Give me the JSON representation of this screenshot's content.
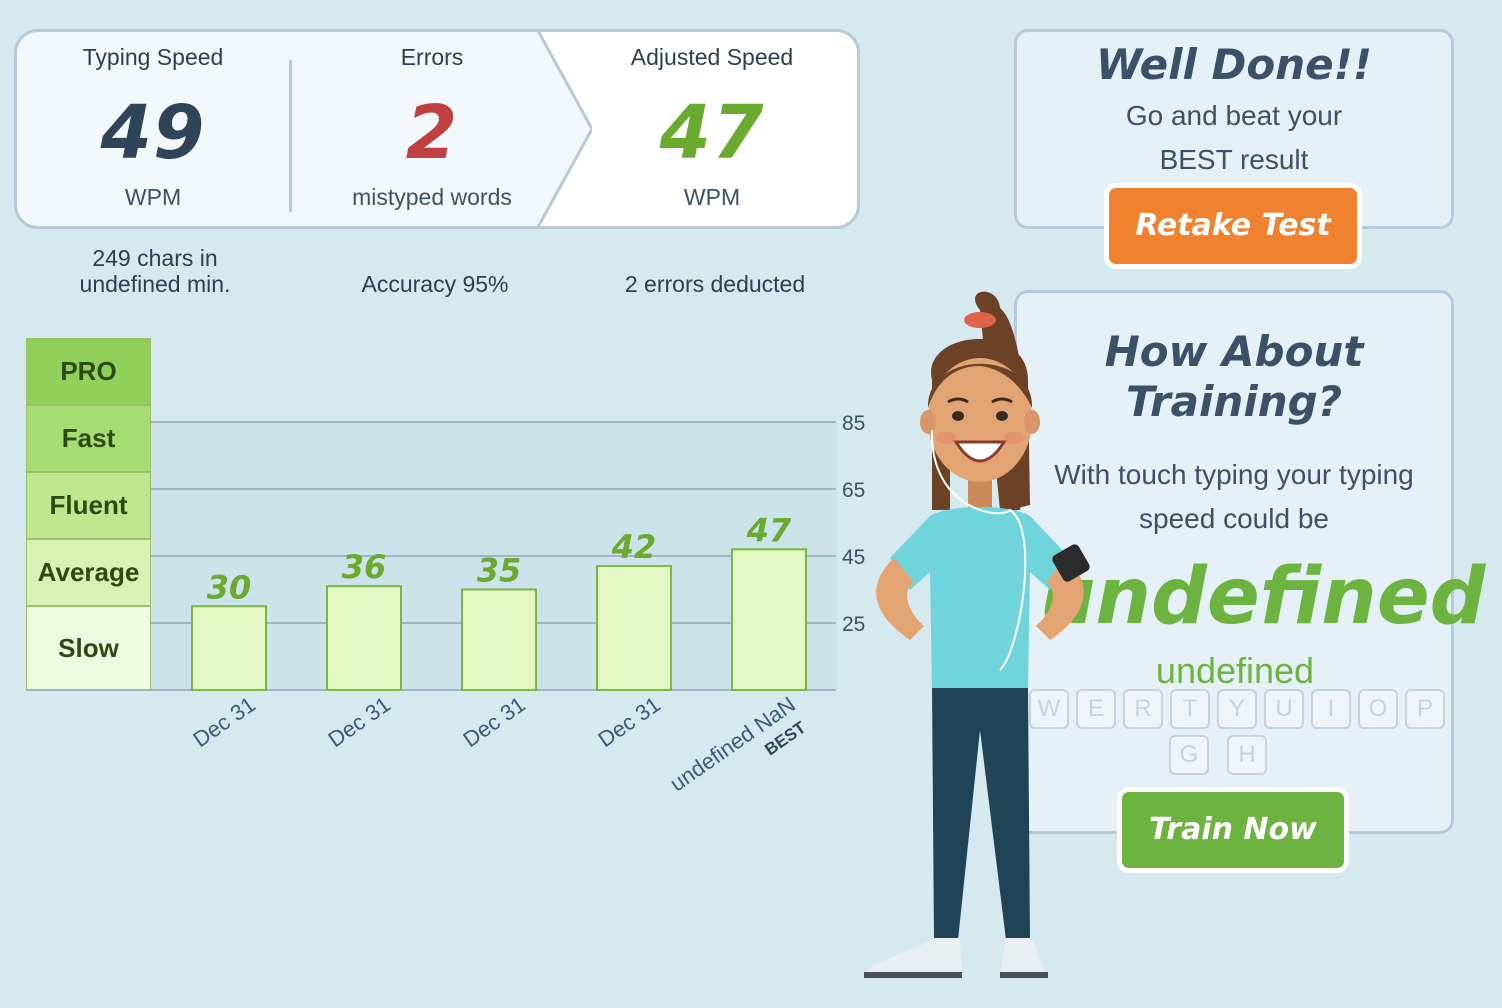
{
  "stats": {
    "typing_speed": {
      "title": "Typing Speed",
      "value": "49",
      "unit": "WPM"
    },
    "errors": {
      "title": "Errors",
      "value": "2",
      "unit": "mistyped words"
    },
    "adjusted_speed": {
      "title": "Adjusted Speed",
      "value": "47",
      "unit": "WPM"
    }
  },
  "subinfo": {
    "chars": "249 chars in undefined min.",
    "accuracy": "Accuracy 95%",
    "deducted": "2 errors deducted"
  },
  "colors": {
    "speed": "#2f4459",
    "errors": "#c0403f",
    "adjusted": "#6aaa2f",
    "bar_fill": "#e3f8c2",
    "bar_border": "#7ab648",
    "retake": "#f0822f",
    "train": "#6db33f"
  },
  "well_done": {
    "heading": "Well Done!!",
    "line1": "Go and beat your",
    "line2": "BEST result",
    "button": "Retake Test"
  },
  "training": {
    "heading1": "How About",
    "heading2": "Training?",
    "line1": "With touch typing your typing",
    "line2": "speed could be",
    "big_value": "undefined",
    "small_value": "undefined",
    "button": "Train Now",
    "keys_row1": [
      "W",
      "E",
      "R",
      "T",
      "Y",
      "U",
      "I",
      "O",
      "P"
    ],
    "keys_row2": [
      "G",
      "H"
    ]
  },
  "levels": [
    "PRO",
    "Fast",
    "Fluent",
    "Average",
    "Slow"
  ],
  "chart_data": {
    "type": "bar",
    "categories": [
      "Dec 31",
      "Dec 31",
      "Dec 31",
      "Dec 31",
      "undefined NaN"
    ],
    "values": [
      30,
      36,
      35,
      42,
      47
    ],
    "best_label": "BEST",
    "best_index": 4,
    "yticks": [
      25,
      45,
      65,
      85
    ],
    "ylim": [
      5,
      105
    ],
    "grid": true,
    "title": "",
    "xlabel": "",
    "ylabel": ""
  }
}
